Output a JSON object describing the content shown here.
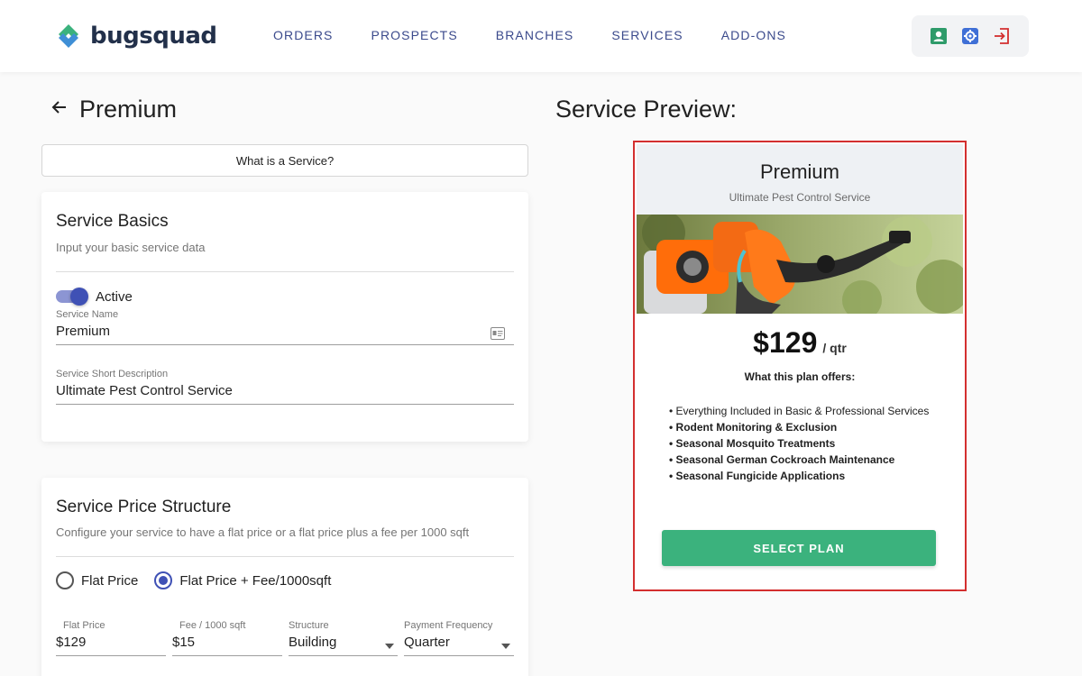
{
  "brand": {
    "name": "bugsquad",
    "accent": "#3bb27d",
    "primary": "#3f51b5"
  },
  "nav": [
    {
      "label": "ORDERS"
    },
    {
      "label": "PROSPECTS"
    },
    {
      "label": "BRANCHES"
    },
    {
      "label": "SERVICES"
    },
    {
      "label": "ADD-ONS"
    }
  ],
  "header_icons": [
    "account-box-icon",
    "settings-icon",
    "logout-icon"
  ],
  "page": {
    "title": "Premium",
    "help_button": "What is a Service?"
  },
  "basics": {
    "title": "Service Basics",
    "subtitle": "Input your basic service data",
    "active_label": "Active",
    "active": true,
    "name_label": "Service Name",
    "name_value": "Premium",
    "desc_label": "Service Short Description",
    "desc_value": "Ultimate Pest Control Service"
  },
  "pricing": {
    "title": "Service Price Structure",
    "subtitle": "Configure your service to have a flat price or a flat price plus a fee per 1000 sqft",
    "option_flat": "Flat Price",
    "option_flat_fee": "Flat Price + Fee/1000sqft",
    "selected": "flat_fee",
    "flat_price_label": "Flat Price",
    "flat_price_value": "$129",
    "fee_label": "Fee / 1000 sqft",
    "fee_value": "$15",
    "structure_label": "Structure",
    "structure_value": "Building",
    "frequency_label": "Payment Frequency",
    "frequency_value": "Quarter"
  },
  "preview": {
    "heading": "Service Preview:",
    "name": "Premium",
    "description": "Ultimate Pest Control Service",
    "price": "$129",
    "period": "/ qtr",
    "offers_title": "What this plan offers:",
    "offers": [
      "Everything Included in Basic & Professional Services",
      "Rodent Monitoring & Exclusion",
      "Seasonal Mosquito Treatments",
      "Seasonal German Cockroach Maintenance",
      "Seasonal Fungicide Applications"
    ],
    "cta": "SELECT PLAN"
  }
}
